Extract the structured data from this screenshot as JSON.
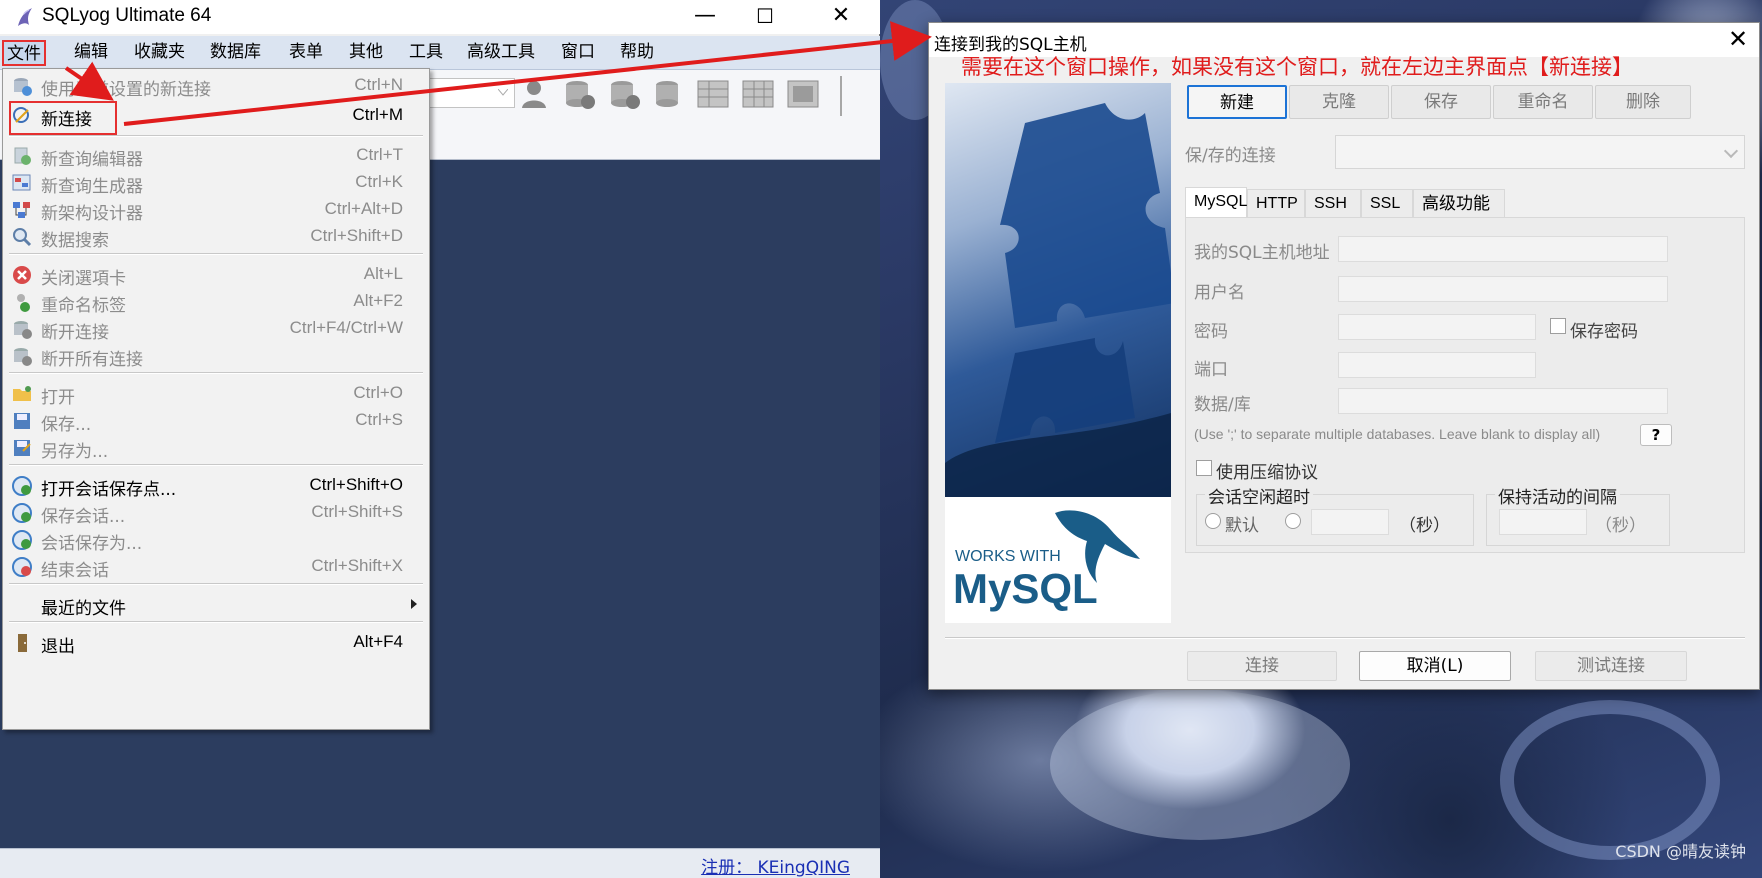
{
  "main_window": {
    "title": "SQLyog Ultimate 64",
    "controls": {
      "minimize": "—",
      "maximize": "☐",
      "close": "✕"
    }
  },
  "menu_bar": [
    "文件",
    "编辑",
    "收藏夹",
    "数据库",
    "表单",
    "其他",
    "工具",
    "高级工具",
    "窗口",
    "帮助"
  ],
  "file_menu": {
    "items": [
      {
        "label": "使用当前设置的新连接",
        "shortcut": "Ctrl+N",
        "enabled": false,
        "icon": "new-connection-current-icon"
      },
      {
        "label": "新连接",
        "shortcut": "Ctrl+M",
        "enabled": true,
        "icon": "new-connection-icon"
      },
      {
        "label": "新查询编辑器",
        "shortcut": "Ctrl+T",
        "enabled": false,
        "icon": "query-editor-icon"
      },
      {
        "label": "新查询生成器",
        "shortcut": "Ctrl+K",
        "enabled": false,
        "icon": "query-builder-icon"
      },
      {
        "label": "新架构设计器",
        "shortcut": "Ctrl+Alt+D",
        "enabled": false,
        "icon": "schema-designer-icon"
      },
      {
        "label": "数据搜索",
        "shortcut": "Ctrl+Shift+D",
        "enabled": false,
        "icon": "data-search-icon"
      },
      {
        "label": "关闭選項卡",
        "shortcut": "Alt+L",
        "enabled": false,
        "icon": "close-tab-icon"
      },
      {
        "label": "重命名标签",
        "shortcut": "Alt+F2",
        "enabled": false,
        "icon": "rename-tab-icon"
      },
      {
        "label": "断开连接",
        "shortcut": "Ctrl+F4/Ctrl+W",
        "enabled": false,
        "icon": "disconnect-icon"
      },
      {
        "label": "断开所有连接",
        "shortcut": "",
        "enabled": false,
        "icon": "disconnect-all-icon"
      },
      {
        "label": "打开",
        "shortcut": "Ctrl+O",
        "enabled": false,
        "icon": "open-folder-icon"
      },
      {
        "label": "保存...",
        "shortcut": "Ctrl+S",
        "enabled": false,
        "icon": "save-icon"
      },
      {
        "label": "另存为...",
        "shortcut": "",
        "enabled": false,
        "icon": "save-as-icon"
      },
      {
        "label": "打开会话保存点...",
        "shortcut": "Ctrl+Shift+O",
        "enabled": true,
        "icon": "open-session-icon"
      },
      {
        "label": "保存会话...",
        "shortcut": "Ctrl+Shift+S",
        "enabled": false,
        "icon": "save-session-icon"
      },
      {
        "label": "会话保存为...",
        "shortcut": "",
        "enabled": false,
        "icon": "save-session-as-icon"
      },
      {
        "label": "结束会话",
        "shortcut": "Ctrl+Shift+X",
        "enabled": false,
        "icon": "end-session-icon"
      },
      {
        "label": "最近的文件",
        "shortcut": "",
        "enabled": true,
        "icon": "",
        "submenu": true
      },
      {
        "label": "退出",
        "shortcut": "Alt+F4",
        "enabled": true,
        "icon": "exit-icon"
      }
    ]
  },
  "status_bar": {
    "register": "注册： KEingQING"
  },
  "dialog": {
    "title": "连接到我的SQL主机",
    "annotation": "需要在这个窗口操作，如果没有这个窗口，就在左边主界面点【新连接】",
    "buttons": [
      "新建",
      "克隆",
      "保存",
      "重命名",
      "删除"
    ],
    "saved_connections_label": "保/存的连接",
    "saved_connections_value": "",
    "tabs": [
      "MySQL",
      "HTTP",
      "SSH",
      "SSL",
      "高级功能"
    ],
    "active_tab": "MySQL",
    "fields": {
      "host_label": "我的SQL主机地址",
      "user_label": "用户名",
      "password_label": "密码",
      "save_password_label": "保存密码",
      "port_label": "端口",
      "database_label": "数据/库",
      "database_hint": "(Use ';' to separate multiple databases. Leave blank to display all)",
      "help_button": "?",
      "compress_label": "使用压缩协议"
    },
    "session_timeout": {
      "title": "会话空闲超时",
      "default_label": "默认",
      "unit": "（秒）"
    },
    "keepalive": {
      "title": "保持活动的间隔",
      "unit": "（秒）"
    },
    "logo": {
      "line1": "WORKS WITH",
      "line2": "MySQL"
    },
    "footer_buttons": {
      "connect": "连接",
      "cancel": "取消(L)",
      "test": "测试连接"
    }
  },
  "watermark": "CSDN @晴友读钟",
  "colors": {
    "annotation_red": "#e01c1c",
    "workspace": "#2c3d5f",
    "accent_blue": "#1c73d6"
  }
}
